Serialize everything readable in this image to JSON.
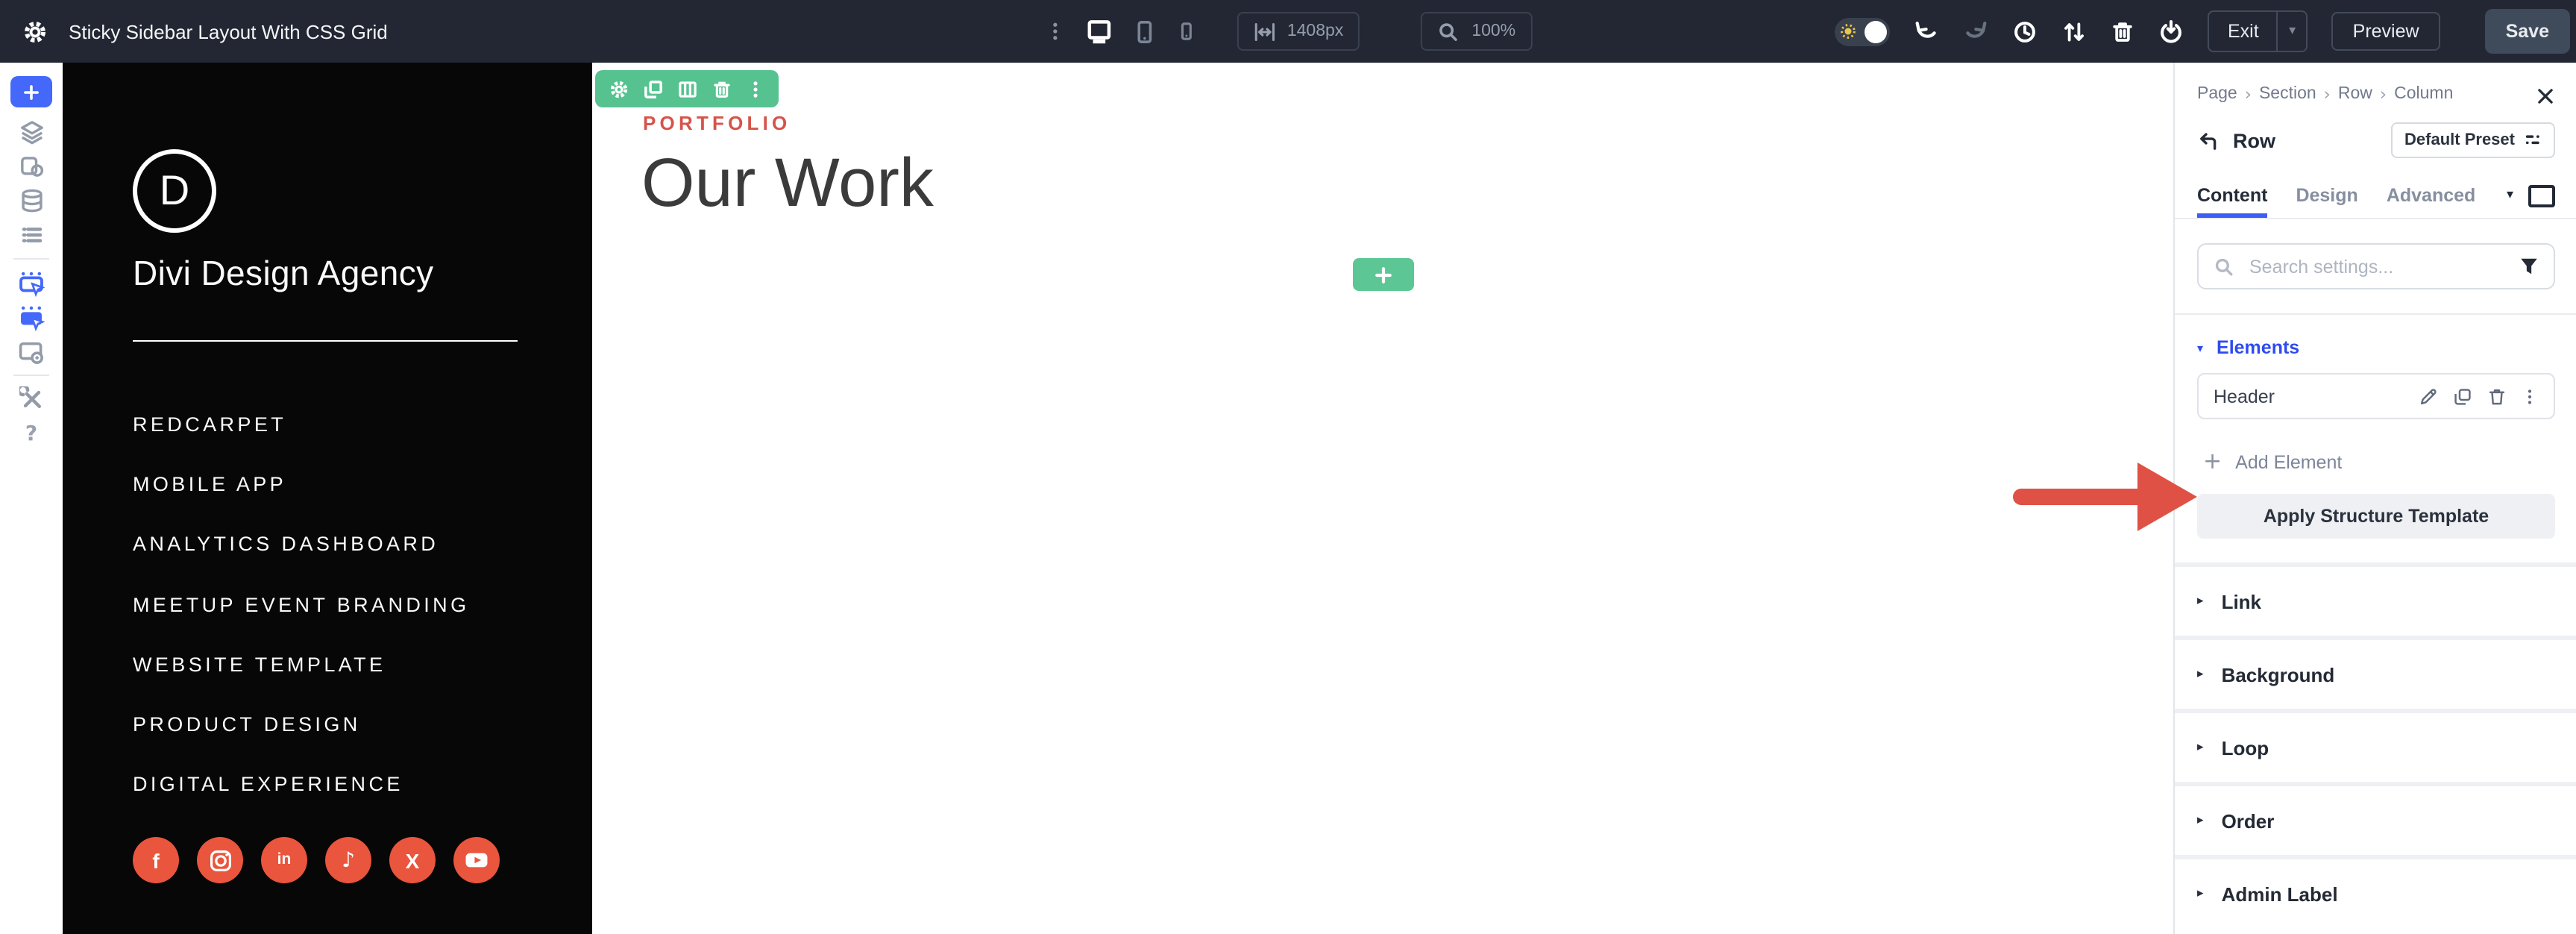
{
  "top_bar": {
    "title": "Sticky Sidebar Layout With CSS Grid",
    "responsive_width_value": "1408px",
    "zoom_value": "100%",
    "exit_label": "Exit",
    "preview_label": "Preview",
    "save_label": "Save",
    "view_icons": [
      "options-ellipsis",
      "desktop",
      "tablet",
      "phone"
    ],
    "action_icons": [
      "light-dark-toggle",
      "undo",
      "redo",
      "history",
      "sort",
      "trash",
      "portability"
    ]
  },
  "builder_toolbar": {
    "icons": [
      "add",
      "layers",
      "pages",
      "database",
      "rows",
      "hover-mode",
      "click-mode",
      "preview-window",
      "tools",
      "help"
    ]
  },
  "page": {
    "sidebar": {
      "logo_letter": "D",
      "brand_name": "Divi Design Agency",
      "menu": [
        "REDCARPET",
        "MOBILE APP",
        "ANALYTICS DASHBOARD",
        "MEETUP EVENT BRANDING",
        "WEBSITE TEMPLATE",
        "PRODUCT DESIGN",
        "DIGITAL EXPERIENCE"
      ],
      "social_networks": [
        "facebook",
        "instagram",
        "linkedin",
        "tiktok",
        "x",
        "youtube"
      ],
      "social_glyphs": {
        "facebook": "f",
        "linkedin": "in",
        "tiktok": "♪",
        "x": "X"
      }
    },
    "content": {
      "eyebrow": "PORTFOLIO",
      "heading": "Our Work"
    },
    "module_toolbar_icons": [
      "settings",
      "duplicate",
      "columns",
      "delete",
      "options"
    ]
  },
  "panel": {
    "breadcrumb": [
      "Page",
      "Section",
      "Row",
      "Column"
    ],
    "breadcrumb_separator": "›",
    "element_title": "Row",
    "preset_button": "Default Preset",
    "tabs": [
      "Content",
      "Design",
      "Advanced"
    ],
    "active_tab": "Content",
    "search": {
      "placeholder": "Search settings..."
    },
    "elements": {
      "heading": "Elements",
      "items": [
        "Header"
      ],
      "item_actions": [
        "edit",
        "duplicate",
        "delete",
        "options"
      ],
      "add_label": "Add Element",
      "apply_label": "Apply Structure Template"
    },
    "sections": [
      "Link",
      "Background",
      "Loop",
      "Order",
      "Admin Label"
    ]
  },
  "glyphs": {
    "plus": "+",
    "caret_down": "▾",
    "triangle_down": "▾",
    "triangle_right": "▸",
    "question": "?"
  },
  "colors": {
    "accent_blue": "#3d5ef5",
    "builder_blue": "#4468fa",
    "green": "#55c290",
    "coral": "#ea553d",
    "eyebrow_red": "#d5544a",
    "arrow_red": "#df5145",
    "top_bar_bg": "#222733",
    "save_bg": "#3f4a5a"
  }
}
